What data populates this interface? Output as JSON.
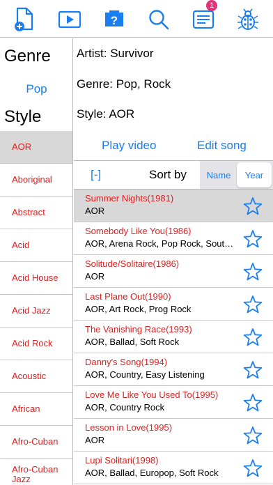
{
  "toolbar": {
    "icons": [
      "new-document-icon",
      "play-video-icon",
      "help-icon",
      "search-icon",
      "messages-icon",
      "bug-icon"
    ],
    "notification_count": "1",
    "accent_color": "#1a7ef0"
  },
  "left": {
    "genre_title": "Genre",
    "genre_value": "Pop",
    "style_title": "Style",
    "styles": [
      "AOR",
      "Aboriginal",
      "Abstract",
      "Acid",
      "Acid House",
      "Acid Jazz",
      "Acid Rock",
      "Acoustic",
      "African",
      "Afro-Cuban",
      "Afro-Cuban Jazz"
    ],
    "selected_style": "AOR"
  },
  "detail": {
    "artist_label": "Artist:",
    "artist_value": "Survivor",
    "genre_label": "Genre:",
    "genre_value": "Pop, Rock",
    "style_label": "Style:",
    "style_value": "AOR",
    "play_video": "Play video",
    "edit_song": "Edit song"
  },
  "sortbar": {
    "collapse": "[-]",
    "sort_by": "Sort by",
    "name": "Name",
    "year": "Year",
    "selected": "Year"
  },
  "songs": [
    {
      "title": "Summer Nights(1981)",
      "styles": "AOR",
      "selected": true
    },
    {
      "title": "Somebody Like You(1986)",
      "styles": "AOR, Arena Rock, Pop Rock, South…"
    },
    {
      "title": "Solitude/Solitaire(1986)",
      "styles": "AOR"
    },
    {
      "title": "Last Plane Out(1990)",
      "styles": "AOR, Art Rock, Prog Rock"
    },
    {
      "title": "The Vanishing Race(1993)",
      "styles": "AOR, Ballad, Soft Rock"
    },
    {
      "title": "Danny's Song(1994)",
      "styles": "AOR, Country, Easy Listening"
    },
    {
      "title": "Love Me Like You Used To(1995)",
      "styles": "AOR, Country Rock"
    },
    {
      "title": "Lesson in Love(1995)",
      "styles": "AOR"
    },
    {
      "title": "Lupi Solitari(1998)",
      "styles": "AOR, Ballad, Europop, Soft Rock"
    }
  ]
}
